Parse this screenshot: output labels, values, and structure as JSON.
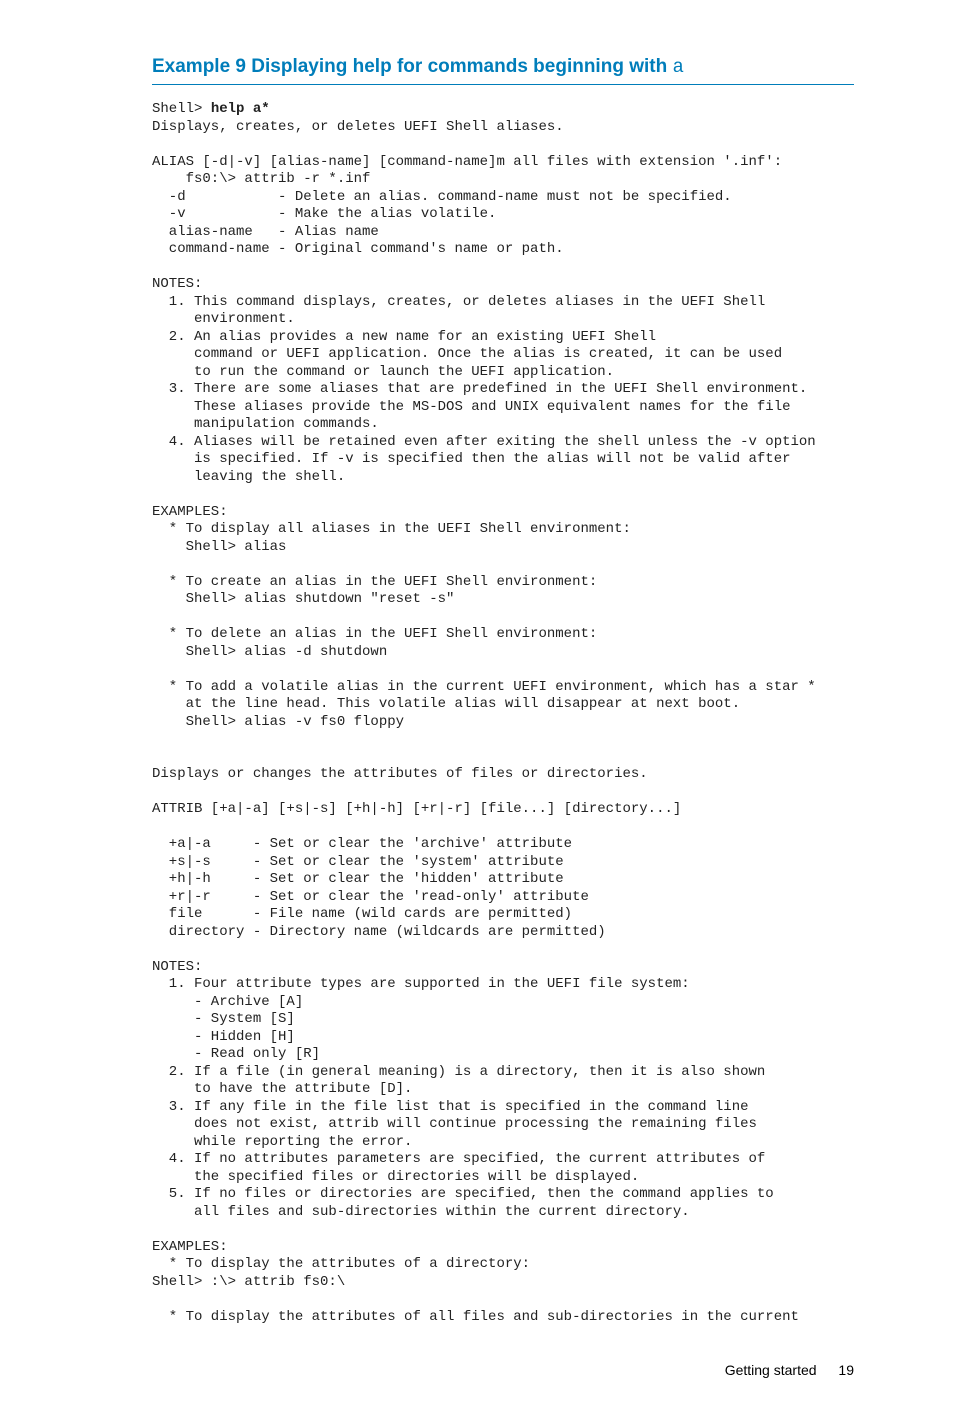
{
  "heading": {
    "prefix": "Example 9 Displaying help for commands beginning with ",
    "mono": "a"
  },
  "code": {
    "prompt_line_prefix": "Shell> ",
    "prompt_line_bold": "help a*",
    "body": "Displays, creates, or deletes UEFI Shell aliases.\n\nALIAS [-d|-v] [alias-name] [command-name]m all files with extension '.inf':\n    fs0:\\> attrib -r *.inf\n  -d           - Delete an alias. command-name must not be specified.\n  -v           - Make the alias volatile.\n  alias-name   - Alias name\n  command-name - Original command's name or path.\n\nNOTES:\n  1. This command displays, creates, or deletes aliases in the UEFI Shell\n     environment.\n  2. An alias provides a new name for an existing UEFI Shell\n     command or UEFI application. Once the alias is created, it can be used\n     to run the command or launch the UEFI application.\n  3. There are some aliases that are predefined in the UEFI Shell environment.\n     These aliases provide the MS-DOS and UNIX equivalent names for the file\n     manipulation commands.\n  4. Aliases will be retained even after exiting the shell unless the -v option\n     is specified. If -v is specified then the alias will not be valid after\n     leaving the shell.\n\nEXAMPLES:\n  * To display all aliases in the UEFI Shell environment:\n    Shell> alias\n\n  * To create an alias in the UEFI Shell environment:\n    Shell> alias shutdown \"reset -s\"\n\n  * To delete an alias in the UEFI Shell environment:\n    Shell> alias -d shutdown\n\n  * To add a volatile alias in the current UEFI environment, which has a star *\n    at the line head. This volatile alias will disappear at next boot.\n    Shell> alias -v fs0 floppy\n\n\nDisplays or changes the attributes of files or directories.\n\nATTRIB [+a|-a] [+s|-s] [+h|-h] [+r|-r] [file...] [directory...]\n\n  +a|-a     - Set or clear the 'archive' attribute\n  +s|-s     - Set or clear the 'system' attribute\n  +h|-h     - Set or clear the 'hidden' attribute\n  +r|-r     - Set or clear the 'read-only' attribute\n  file      - File name (wild cards are permitted)\n  directory - Directory name (wildcards are permitted)\n\nNOTES:\n  1. Four attribute types are supported in the UEFI file system:\n     - Archive [A]\n     - System [S]\n     - Hidden [H]\n     - Read only [R]\n  2. If a file (in general meaning) is a directory, then it is also shown\n     to have the attribute [D].\n  3. If any file in the file list that is specified in the command line\n     does not exist, attrib will continue processing the remaining files\n     while reporting the error.\n  4. If no attributes parameters are specified, the current attributes of\n     the specified files or directories will be displayed.\n  5. If no files or directories are specified, then the command applies to\n     all files and sub-directories within the current directory.\n\nEXAMPLES:\n  * To display the attributes of a directory:\nShell> :\\> attrib fs0:\\\n\n  * To display the attributes of all files and sub-directories in the current"
  },
  "footer": {
    "section": "Getting started",
    "page": "19"
  }
}
